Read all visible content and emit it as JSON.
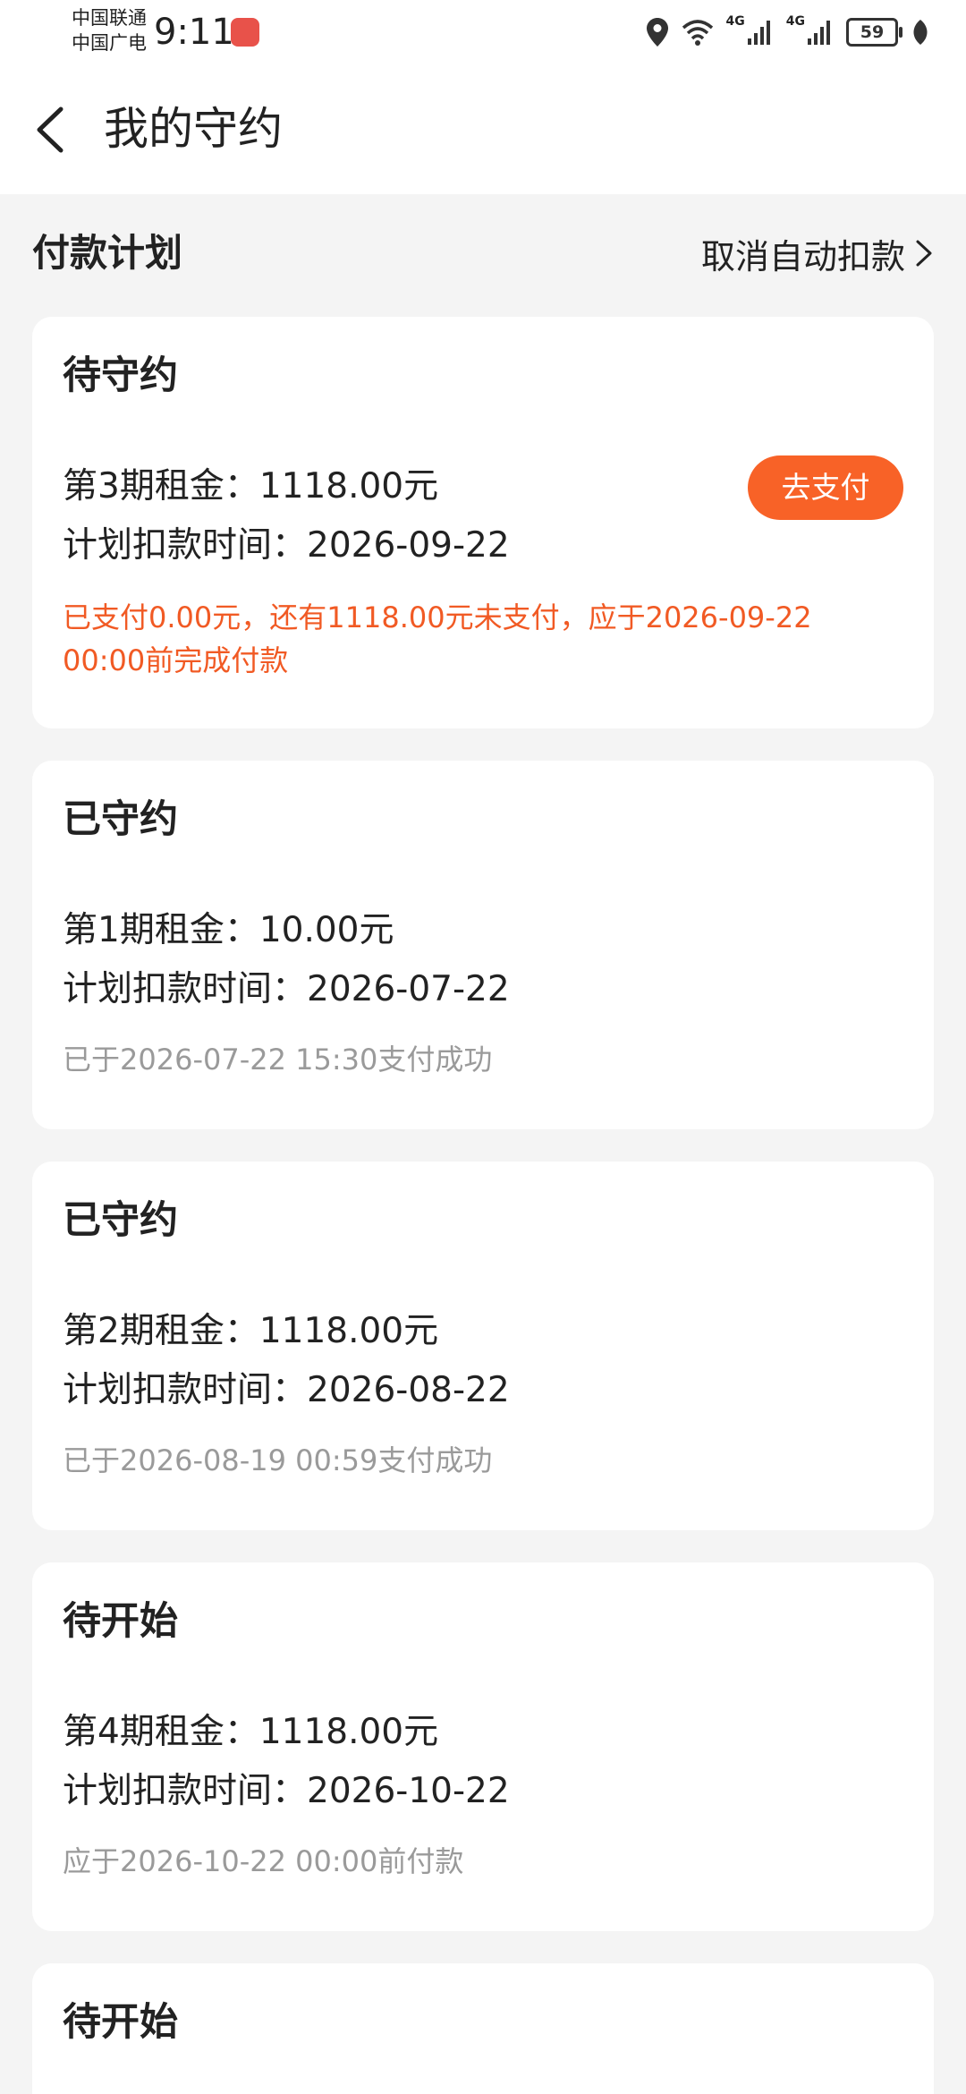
{
  "status_bar": {
    "carrier_1": "中国联通",
    "carrier_2": "中国广电",
    "time": "9:11",
    "network_1": "4G",
    "network_2": "4G",
    "battery": "59",
    "icons": [
      "location-icon",
      "wifi-icon",
      "signal-icon",
      "battery-icon",
      "leaf-icon"
    ]
  },
  "header": {
    "title": "我的守约",
    "back_icon": "chevron-left-icon"
  },
  "section": {
    "title": "付款计划",
    "cancel_label": "取消自动扣款"
  },
  "cards": [
    {
      "status": "待守约",
      "rent": "第3期租金：1118.00元",
      "time": "计划扣款时间：2026-09-22",
      "note": "已支付0.00元，还有1118.00元未支付，应于2026-09-22 00:00前完成付款",
      "button": "去支付"
    },
    {
      "status": "已守约",
      "rent": "第1期租金：10.00元",
      "time": "计划扣款时间：2026-07-22",
      "note": "已于2026-07-22 15:30支付成功"
    },
    {
      "status": "已守约",
      "rent": "第2期租金：1118.00元",
      "time": "计划扣款时间：2026-08-22",
      "note": "已于2026-08-19 00:59支付成功"
    },
    {
      "status": "待开始",
      "rent": "第4期租金：1118.00元",
      "time": "计划扣款时间：2026-10-22",
      "note": "应于2026-10-22 00:00前付款"
    },
    {
      "status": "待开始"
    }
  ],
  "colors": {
    "accent": "#f86227",
    "warning_text": "#f15a24",
    "muted_text": "#9a9a9a",
    "background": "#f4f4f4"
  }
}
